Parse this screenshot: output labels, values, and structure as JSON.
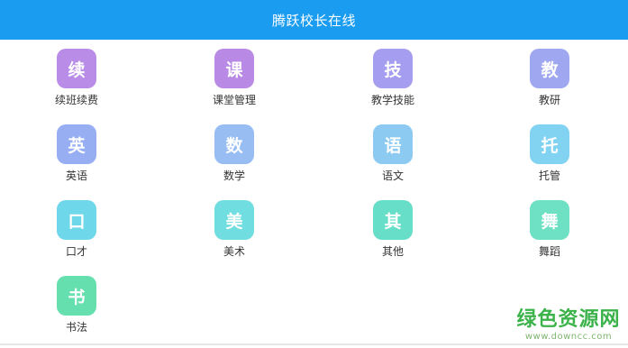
{
  "header": {
    "title": "腾跃校长在线"
  },
  "tiles": [
    {
      "glyph": "续",
      "label": "续班续费",
      "color": "#b98ce8"
    },
    {
      "glyph": "课",
      "label": "课堂管理",
      "color": "#b88ae6"
    },
    {
      "glyph": "技",
      "label": "教学技能",
      "color": "#a59df0"
    },
    {
      "glyph": "教",
      "label": "教研",
      "color": "#9fa7f1"
    },
    {
      "glyph": "英",
      "label": "英语",
      "color": "#98aef2"
    },
    {
      "glyph": "数",
      "label": "数学",
      "color": "#98bdf3"
    },
    {
      "glyph": "语",
      "label": "语文",
      "color": "#8ccaf2"
    },
    {
      "glyph": "托",
      "label": "托管",
      "color": "#82d2f1"
    },
    {
      "glyph": "口",
      "label": "口才",
      "color": "#6fd7ea"
    },
    {
      "glyph": "美",
      "label": "美术",
      "color": "#70dde0"
    },
    {
      "glyph": "其",
      "label": "其他",
      "color": "#67dfc8"
    },
    {
      "glyph": "舞",
      "label": "舞蹈",
      "color": "#6ee0c4"
    },
    {
      "glyph": "书",
      "label": "书法",
      "color": "#66dfae"
    }
  ],
  "watermark": {
    "title": "绿色资源网",
    "url": "www.downcc.com"
  }
}
